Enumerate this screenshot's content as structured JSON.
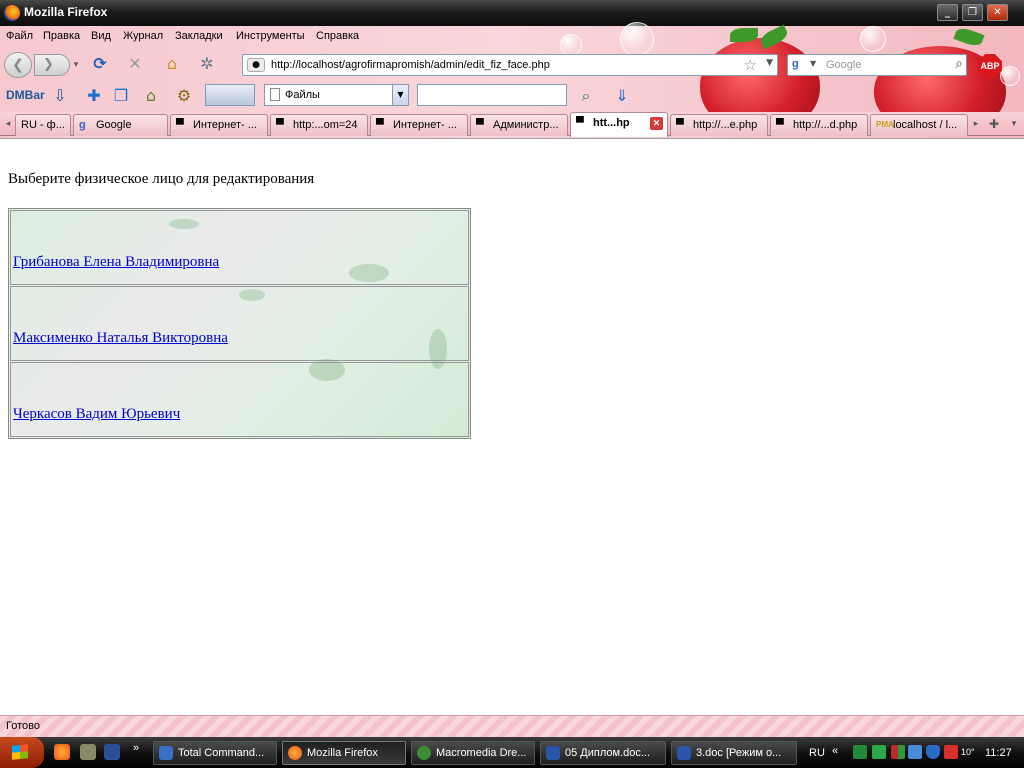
{
  "window": {
    "title": "Mozilla Firefox"
  },
  "menu": [
    "Файл",
    "Правка",
    "Вид",
    "Журнал",
    "Закладки",
    "Инструменты",
    "Справка"
  ],
  "navigation": {
    "url": "http://localhost/agrofirmapromish/admin/edit_fiz_face.php",
    "search_placeholder": "Google"
  },
  "toolbar": {
    "dmbar_label": "DMBar",
    "combo_value": "Файлы",
    "abp_label": "ABP"
  },
  "tabs": [
    {
      "label": "RU - ф..."
    },
    {
      "label": "Google"
    },
    {
      "label": "Интернет- ..."
    },
    {
      "label": "http:...om=24"
    },
    {
      "label": "Интернет- ..."
    },
    {
      "label": "Администр..."
    },
    {
      "label": "htt...hp",
      "active": true
    },
    {
      "label": "http://...e.php"
    },
    {
      "label": "http://...d.php"
    },
    {
      "label": "localhost / l..."
    }
  ],
  "page": {
    "prompt": "Выберите физическое лицо для редактирования",
    "persons": [
      "Грибанова Елена Владимировна",
      "Максименко Наталья Викторовна",
      "Черкасов Вадим Юрьевич"
    ]
  },
  "status": {
    "text": "Готово"
  },
  "taskbar": {
    "tasks": [
      {
        "label": "Total Command..."
      },
      {
        "label": "Mozilla Firefox",
        "active": true
      },
      {
        "label": "Macromedia Dre..."
      },
      {
        "label": "05 Диплом.doc..."
      },
      {
        "label": "3.doc [Режим о..."
      }
    ],
    "language": "RU",
    "clock": "11:27",
    "temperature": "10°"
  },
  "colors": {
    "link": "#0000cc",
    "theme_pink": "#f6c9cf",
    "taskbar": "#111111"
  }
}
